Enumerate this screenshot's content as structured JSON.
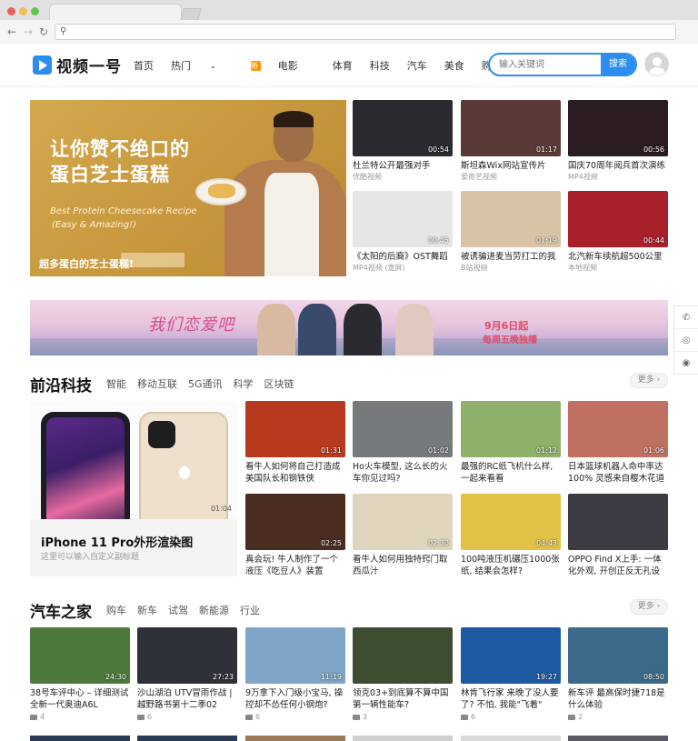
{
  "browser": {
    "search_icon": "search-icon"
  },
  "site": {
    "logo": "视频一号",
    "nav": [
      "首页",
      "热门",
      "电影",
      "体育",
      "科技",
      "汽车",
      "美食",
      "购买"
    ],
    "movie_badge": "新",
    "search_placeholder": "输入关键词",
    "search_button": "搜索"
  },
  "hero": {
    "title_line1": "让你赞不绝口的",
    "title_line2": "蛋白芝士蛋糕",
    "en_line1": "Best Protein Cheesecake Recipe",
    "en_line2": "(Easy & Amazing!)",
    "caption": "超多蛋白的芝士蛋糕!",
    "slides": 3,
    "active_slide": 3
  },
  "top_cards": [
    {
      "title": "杜兰特公开最强对手",
      "source": "优酷视频",
      "duration": "00:54",
      "bg": "#2a2a30"
    },
    {
      "title": "斯坦森Wix网站宣传片",
      "source": "爱奇艺视频",
      "duration": "01:17",
      "bg": "#5a3a36"
    },
    {
      "title": "国庆70周年阅兵首次演练",
      "source": "MP4视频",
      "duration": "00:56",
      "bg": "#2a1c22"
    },
    {
      "title": "《太阳的后裔》OST舞蹈",
      "source": "MP4视频 (宽屏)",
      "duration": "00:45",
      "bg": "#e8e6e4"
    },
    {
      "title": "被诱骗进麦当劳打工的我",
      "source": "B站视频",
      "duration": "01:19",
      "bg": "#d8c3a6"
    },
    {
      "title": "北汽新车续航超500公里",
      "source": "本地视频",
      "duration": "00:44",
      "bg": "#a8202a"
    }
  ],
  "banner": {
    "slogan": "我们恋爱吧",
    "date": "9月6日起",
    "sub": "每周五晚独播"
  },
  "tech": {
    "title": "前沿科技",
    "tags": [
      "智能",
      "移动互联",
      "5G通讯",
      "科学",
      "区块链"
    ],
    "more": "更多",
    "feature": {
      "title": "iPhone 11 Pro外形渲染图",
      "subtitle": "这里可以输入自定义副标题",
      "duration": "01:04"
    },
    "cards": [
      {
        "title": "看牛人如何将自己打造成美国队长和钢铁侠",
        "duration": "01:31",
        "bg": "#b83a1e"
      },
      {
        "title": "Ho火车模型, 这么长的火车你见过吗?",
        "duration": "01:02",
        "bg": "#777a7c"
      },
      {
        "title": "最强的RC纸飞机什么样, 一起来看看",
        "duration": "01:12",
        "bg": "#8fb06a"
      },
      {
        "title": "日本篮球机器人命中率达100% 灵感来自樱木花道",
        "duration": "01:06",
        "bg": "#c07060"
      },
      {
        "title": "真会玩! 牛人制作了一个液压《吃豆人》装置",
        "duration": "02:25",
        "bg": "#4a2d20"
      },
      {
        "title": "看牛人如何用独特窍门取西瓜汁",
        "duration": "02:30",
        "bg": "#dfd5bc"
      },
      {
        "title": "100吨液压机碾压1000张纸, 结果会怎样?",
        "duration": "04:43",
        "bg": "#e2c246"
      },
      {
        "title": "OPPO Find X上手: 一体化外观, 开创正反无孔设计!",
        "duration": "",
        "bg": "#3b3b44"
      }
    ]
  },
  "auto": {
    "title": "汽车之家",
    "tags": [
      "购车",
      "新车",
      "试驾",
      "新能源",
      "行业"
    ],
    "more": "更多",
    "cards": [
      {
        "title": "38号车评中心 – 详细测试全新一代奥迪A6L",
        "duration": "24:30",
        "views": "4",
        "bg": "#4b7a3a"
      },
      {
        "title": "沙山湖泊 UTV冒雨作战 | 越野路书第十二季02",
        "duration": "27:23",
        "views": "6",
        "bg": "#2e3238"
      },
      {
        "title": "9万拿下入门级小宝马, 操控却不怂任何小钢炮?",
        "duration": "11:19",
        "views": "6",
        "bg": "#7fa6c6"
      },
      {
        "title": "领克03+到底算不算中国第一辆性能车?",
        "duration": "",
        "views": "3",
        "bg": "#3c4d32"
      },
      {
        "title": "林肯飞行家 来晚了没人要了? 不怕, 我能\"飞着\"",
        "duration": "19:27",
        "views": "6",
        "bg": "#1c5aa2"
      },
      {
        "title": "新车评 最高保时捷718是什么体验",
        "duration": "08:50",
        "views": "2",
        "bg": "#3b6a8a"
      }
    ]
  },
  "side_dock": [
    "phone-icon",
    "wechat-icon",
    "weibo-icon"
  ]
}
